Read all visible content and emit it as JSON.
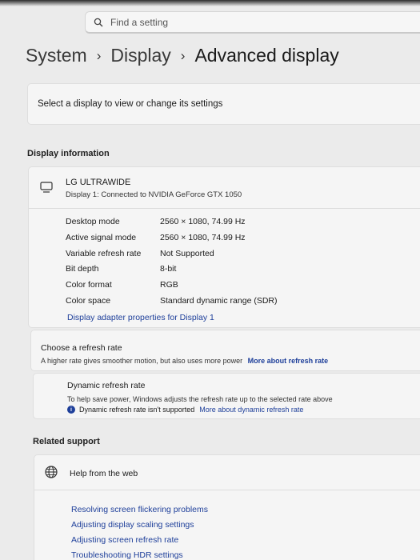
{
  "search": {
    "placeholder": "Find a setting"
  },
  "breadcrumb": {
    "level1": "System",
    "level2": "Display",
    "level3": "Advanced display"
  },
  "select_display": {
    "label": "Select a display to view or change its settings"
  },
  "display_information": {
    "section_title": "Display information",
    "monitor_name": "LG ULTRAWIDE",
    "monitor_subtitle": "Display 1: Connected to NVIDIA GeForce GTX 1050",
    "rows": [
      {
        "key": "Desktop mode",
        "value": "2560 × 1080, 74.99 Hz"
      },
      {
        "key": "Active signal mode",
        "value": "2560 × 1080, 74.99 Hz"
      },
      {
        "key": "Variable refresh rate",
        "value": "Not Supported"
      },
      {
        "key": "Bit depth",
        "value": "8-bit"
      },
      {
        "key": "Color format",
        "value": "RGB"
      },
      {
        "key": "Color space",
        "value": "Standard dynamic range (SDR)"
      }
    ],
    "adapter_link": "Display adapter properties for Display 1"
  },
  "refresh_rate": {
    "title": "Choose a refresh rate",
    "description": "A higher rate gives smoother motion, but also uses more power",
    "more_link": "More about refresh rate"
  },
  "dynamic_refresh": {
    "title": "Dynamic refresh rate",
    "description": "To help save power, Windows adjusts the refresh rate up to the selected rate above",
    "note": "Dynamic refresh rate isn't supported",
    "more_link": "More about dynamic refresh rate"
  },
  "related_support": {
    "section_title": "Related support",
    "help_label": "Help from the web",
    "links": [
      "Resolving screen flickering problems",
      "Adjusting display scaling settings",
      "Adjusting screen refresh rate",
      "Troubleshooting HDR settings"
    ]
  },
  "colors": {
    "accent": "#1e3f9a",
    "background": "#ebebeb",
    "card": "#f5f5f5"
  }
}
